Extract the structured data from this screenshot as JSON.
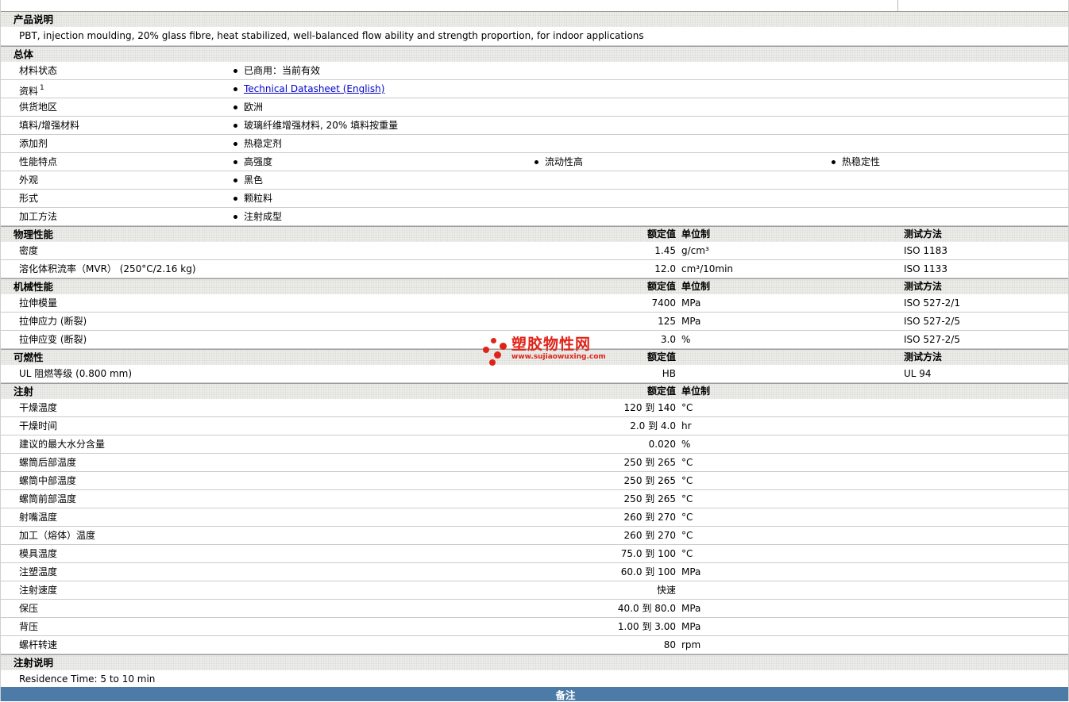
{
  "logo": {
    "name": "塑胶物性网",
    "url_text": "www.sujiaowuxing.com",
    "color": "#e02318"
  },
  "footer": {
    "label": "备注"
  },
  "sections": [
    {
      "key": "product-description",
      "kind": "text",
      "title": "产品说明",
      "rows": [
        {
          "text": "PBT, injection moulding, 20% glass fibre, heat stabilized, well-balanced flow ability and strength proportion, for indoor applications"
        }
      ]
    },
    {
      "key": "general",
      "kind": "bullets",
      "title": "总体",
      "rows": [
        {
          "label": "材料状态",
          "bullets": [
            {
              "text": "已商用：当前有效"
            }
          ]
        },
        {
          "label": "资料",
          "sup": "1",
          "bullets": [
            {
              "text": "Technical Datasheet (English)",
              "link": true
            }
          ]
        },
        {
          "label": "供货地区",
          "bullets": [
            {
              "text": "欧洲"
            }
          ]
        },
        {
          "label": "填料/增强材料",
          "bullets": [
            {
              "text": "玻璃纤维增强材料, 20% 填料按重量"
            }
          ]
        },
        {
          "label": "添加剂",
          "bullets": [
            {
              "text": "热稳定剂"
            }
          ]
        },
        {
          "label": "性能特点",
          "bullets": [
            {
              "text": "高强度"
            },
            {
              "text": "流动性高"
            },
            {
              "text": "热稳定性"
            }
          ]
        },
        {
          "label": "外观",
          "bullets": [
            {
              "text": "黑色"
            }
          ]
        },
        {
          "label": "形式",
          "bullets": [
            {
              "text": "颗粒料"
            }
          ]
        },
        {
          "label": "加工方法",
          "bullets": [
            {
              "text": "注射成型"
            }
          ]
        }
      ]
    },
    {
      "key": "physical-properties",
      "kind": "values",
      "title": "物理性能",
      "columns": {
        "rated": "额定值",
        "unit": "单位制",
        "method": "测试方法"
      },
      "rows": [
        {
          "label": "密度",
          "value": "1.45",
          "unit": "g/cm³",
          "method": "ISO 1183"
        },
        {
          "label": "溶化体积流率（MVR）  (250°C/2.16 kg)",
          "value": "12.0",
          "unit": "cm³/10min",
          "method": "ISO 1133"
        }
      ]
    },
    {
      "key": "mechanical-properties",
      "kind": "values",
      "title": "机械性能",
      "columns": {
        "rated": "额定值",
        "unit": "单位制",
        "method": "测试方法"
      },
      "rows": [
        {
          "label": "拉伸模量",
          "value": "7400",
          "unit": "MPa",
          "method": "ISO 527-2/1"
        },
        {
          "label": "拉伸应力  (断裂)",
          "value": "125",
          "unit": "MPa",
          "method": "ISO 527-2/5"
        },
        {
          "label": "拉伸应变  (断裂)",
          "value": "3.0",
          "unit": "%",
          "method": "ISO 527-2/5"
        }
      ]
    },
    {
      "key": "flammability",
      "kind": "values",
      "title": "可燃性",
      "columns": {
        "rated": "额定值",
        "unit": "",
        "method": "测试方法"
      },
      "rows": [
        {
          "label": "UL 阻燃等级  (0.800 mm)",
          "value": "HB",
          "unit": "",
          "method": "UL 94"
        }
      ]
    },
    {
      "key": "injection",
      "kind": "values",
      "title": "注射",
      "columns": {
        "rated": "额定值",
        "unit": "单位制",
        "method": ""
      },
      "rows": [
        {
          "label": "干燥温度",
          "value": "120 到 140",
          "unit": "°C"
        },
        {
          "label": "干燥时间",
          "value": "2.0 到 4.0",
          "unit": "hr"
        },
        {
          "label": "建议的最大水分含量",
          "value": "0.020",
          "unit": "%"
        },
        {
          "label": "螺筒后部温度",
          "value": "250 到 265",
          "unit": "°C"
        },
        {
          "label": "螺筒中部温度",
          "value": "250 到 265",
          "unit": "°C"
        },
        {
          "label": "螺筒前部温度",
          "value": "250 到 265",
          "unit": "°C"
        },
        {
          "label": "射嘴温度",
          "value": "260 到 270",
          "unit": "°C"
        },
        {
          "label": "加工（熔体）温度",
          "value": "260 到 270",
          "unit": "°C"
        },
        {
          "label": "模具温度",
          "value": "75.0 到 100",
          "unit": "°C"
        },
        {
          "label": "注塑温度",
          "value": "60.0 到 100",
          "unit": "MPa"
        },
        {
          "label": "注射速度",
          "value": "快速",
          "unit": ""
        },
        {
          "label": "保压",
          "value": "40.0 到 80.0",
          "unit": "MPa"
        },
        {
          "label": "背压",
          "value": "1.00 到 3.00",
          "unit": "MPa"
        },
        {
          "label": "螺杆转速",
          "value": "80",
          "unit": "rpm"
        }
      ]
    },
    {
      "key": "injection-notes",
      "kind": "text",
      "title": "注射说明",
      "rows": [
        {
          "text": "Residence Time: 5 to 10 min"
        }
      ]
    }
  ]
}
